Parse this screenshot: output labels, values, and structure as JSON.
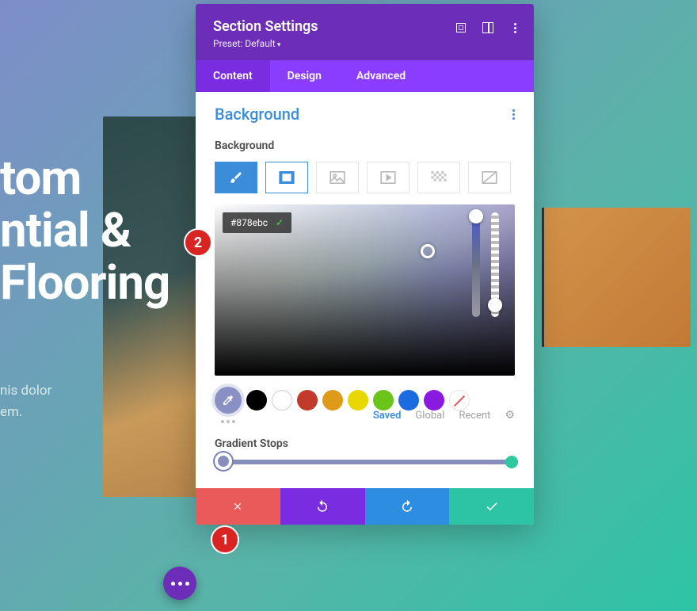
{
  "hero": {
    "line1": "tom",
    "line2": "ntial &",
    "line3": "Flooring",
    "sub1": "nis dolor",
    "sub2": "em."
  },
  "modal": {
    "title": "Section Settings",
    "preset_label": "Preset: Default"
  },
  "tabs": {
    "content": "Content",
    "design": "Design",
    "advanced": "Advanced"
  },
  "section": {
    "title": "Background",
    "label": "Background"
  },
  "color": {
    "hex": "#878ebc"
  },
  "swatches": {
    "black": "#000000",
    "white": "#ffffff",
    "red": "#c23a2b",
    "orange": "#e09a1a",
    "yellow": "#e8d800",
    "green": "#6ac41a",
    "blue": "#1a6ae0",
    "purple": "#8a1ae0"
  },
  "palette_tabs": {
    "saved": "Saved",
    "global": "Global",
    "recent": "Recent"
  },
  "gradient": {
    "label": "Gradient Stops"
  },
  "annotations": {
    "one": "1",
    "two": "2"
  }
}
